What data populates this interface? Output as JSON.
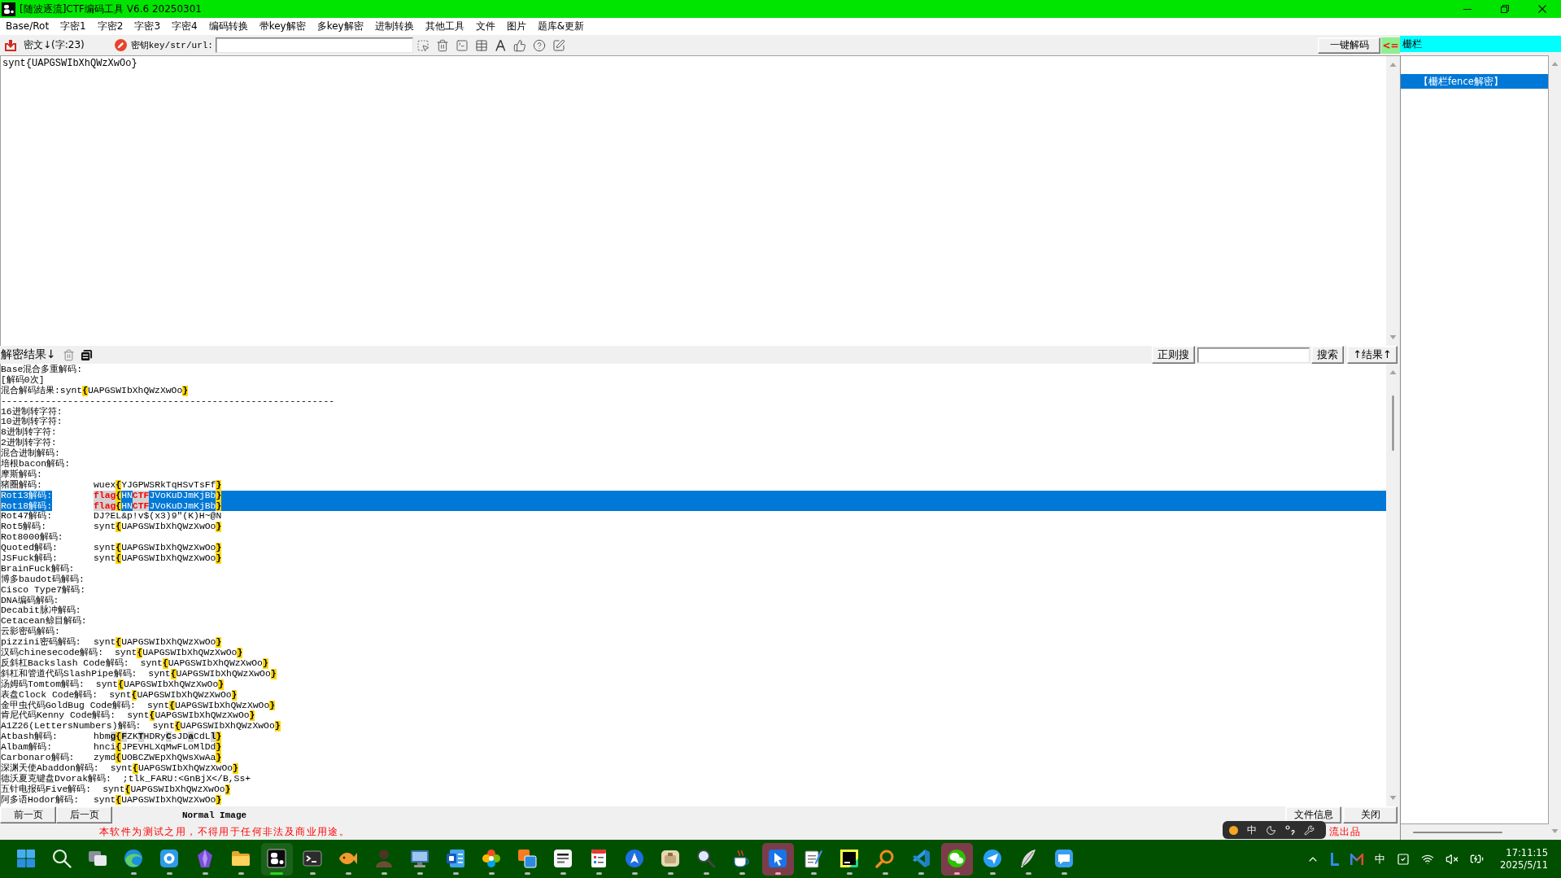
{
  "window": {
    "title": "[随波逐流]CTF编码工具 V6.6 20250301"
  },
  "menu": [
    "Base/Rot",
    "字密1",
    "字密2",
    "字密3",
    "字密4",
    "编码转换",
    "带key解密",
    "多key解密",
    "进制转换",
    "其他工具",
    "文件",
    "图片",
    "题库&更新"
  ],
  "toolbar": {
    "cipher_label": "密文↓(字:23)",
    "key_label": "密钥key/str/url:",
    "decode_button": "一键解码",
    "arrow": "<="
  },
  "mode_field": {
    "value": "栅栏"
  },
  "ciphertext": {
    "value": "synt{UAPGSWIbXhQWzXwOo}"
  },
  "results_header": {
    "title": "解密结果↓",
    "regex_button": "正则搜",
    "search_button": "搜索",
    "results_button": "↑结果↑"
  },
  "results": {
    "lines": [
      {
        "kind": "plain",
        "label": "Base混合多重解码:",
        "selected": false
      },
      {
        "kind": "plain",
        "label": "[解码0次]",
        "selected": false
      },
      {
        "kind": "joined",
        "label": "混合解码结果:",
        "selected": false,
        "value": [
          {
            "text": "synt",
            "kind": "plain"
          },
          {
            "text": "{",
            "kind": "brace"
          },
          {
            "text": "UAPGSWIbXhQWzXwOo",
            "kind": "plain"
          },
          {
            "text": "}",
            "kind": "brace"
          }
        ]
      },
      {
        "kind": "plain",
        "label": "------------------------------------------------------------",
        "selected": false
      },
      {
        "kind": "plain",
        "label": "16进制转字符:",
        "selected": false
      },
      {
        "kind": "plain",
        "label": "10进制转字符:",
        "selected": false
      },
      {
        "kind": "plain",
        "label": "8进制转字符:",
        "selected": false
      },
      {
        "kind": "plain",
        "label": "2进制转字符:",
        "selected": false
      },
      {
        "kind": "plain",
        "label": "混合进制解码:",
        "selected": false
      },
      {
        "kind": "plain",
        "label": "培根bacon解码:",
        "selected": false
      },
      {
        "kind": "plain",
        "label": "摩斯解码:",
        "selected": false
      },
      {
        "kind": "pair",
        "label": "猪圈解码:",
        "selected": false,
        "value": [
          {
            "text": "wuex",
            "kind": "plain"
          },
          {
            "text": "{",
            "kind": "brace"
          },
          {
            "text": "YJGPWSRkTqHSvTsFf",
            "kind": "plain"
          },
          {
            "text": "}",
            "kind": "brace"
          }
        ]
      },
      {
        "kind": "pair",
        "label": "Rot13解码:",
        "selected": true,
        "value": [
          {
            "text": "flag",
            "kind": "flag"
          },
          {
            "text": "{",
            "kind": "brace"
          },
          {
            "text": "HN",
            "kind": "plain"
          },
          {
            "text": "CTF",
            "kind": "flag"
          },
          {
            "text": "JVoKuDJmKjBb",
            "kind": "plain"
          },
          {
            "text": "}",
            "kind": "brace"
          }
        ]
      },
      {
        "kind": "pair",
        "label": "Rot18解码:",
        "selected": true,
        "value": [
          {
            "text": "flag",
            "kind": "flag"
          },
          {
            "text": "{",
            "kind": "brace"
          },
          {
            "text": "HN",
            "kind": "plain"
          },
          {
            "text": "CTF",
            "kind": "flag"
          },
          {
            "text": "JVoKuDJmKjBb",
            "kind": "plain"
          },
          {
            "text": "}",
            "kind": "brace"
          }
        ]
      },
      {
        "kind": "pair",
        "label": "Rot47解码:",
        "selected": false,
        "value": [
          {
            "text": "DJ?EL&p!v$(x3)9\"(K)H~@N",
            "kind": "plain"
          }
        ]
      },
      {
        "kind": "pair",
        "label": "Rot5解码:",
        "selected": false,
        "value": [
          {
            "text": "synt",
            "kind": "plain"
          },
          {
            "text": "{",
            "kind": "brace"
          },
          {
            "text": "UAPGSWIbXhQWzXwOo",
            "kind": "plain"
          },
          {
            "text": "}",
            "kind": "brace"
          }
        ]
      },
      {
        "kind": "plain",
        "label": "Rot8000解码:",
        "selected": false
      },
      {
        "kind": "pair",
        "label": "Quoted解码:",
        "selected": false,
        "value": [
          {
            "text": "synt",
            "kind": "plain"
          },
          {
            "text": "{",
            "kind": "brace"
          },
          {
            "text": "UAPGSWIbXhQWzXwOo",
            "kind": "plain"
          },
          {
            "text": "}",
            "kind": "brace"
          }
        ]
      },
      {
        "kind": "pair",
        "label": "JSFuck解码:",
        "selected": false,
        "value": [
          {
            "text": "synt",
            "kind": "plain"
          },
          {
            "text": "{",
            "kind": "brace"
          },
          {
            "text": "UAPGSWIbXhQWzXwOo",
            "kind": "plain"
          },
          {
            "text": "}",
            "kind": "brace"
          }
        ]
      },
      {
        "kind": "plain",
        "label": "BrainFuck解码:",
        "selected": false
      },
      {
        "kind": "plain",
        "label": "博多baudot码解码:",
        "selected": false
      },
      {
        "kind": "plain",
        "label": "Cisco Type7解码:",
        "selected": false
      },
      {
        "kind": "plain",
        "label": "DNA编码解码:",
        "selected": false
      },
      {
        "kind": "plain",
        "label": "Decabit脉冲解码:",
        "selected": false
      },
      {
        "kind": "plain",
        "label": "Cetacean鲸目解码:",
        "selected": false
      },
      {
        "kind": "plain",
        "label": "云影密码解码:",
        "selected": false
      },
      {
        "kind": "pair",
        "label": "pizzini密码解码:",
        "selected": false,
        "value": [
          {
            "text": "synt",
            "kind": "plain"
          },
          {
            "text": "{",
            "kind": "brace"
          },
          {
            "text": "UAPGSWIbXhQWzXwOo",
            "kind": "plain"
          },
          {
            "text": "}",
            "kind": "brace"
          }
        ]
      },
      {
        "kind": "pair",
        "label": "汉码chinesecode解码:",
        "selected": false,
        "value": [
          {
            "text": "synt",
            "kind": "plain"
          },
          {
            "text": "{",
            "kind": "brace"
          },
          {
            "text": "UAPGSWIbXhQWzXwOo",
            "kind": "plain"
          },
          {
            "text": "}",
            "kind": "brace"
          }
        ]
      },
      {
        "kind": "pair",
        "label": "反斜杠Backslash Code解码:",
        "selected": false,
        "value": [
          {
            "text": "synt",
            "kind": "plain"
          },
          {
            "text": "{",
            "kind": "brace"
          },
          {
            "text": "UAPGSWIbXhQWzXwOo",
            "kind": "plain"
          },
          {
            "text": "}",
            "kind": "brace"
          }
        ]
      },
      {
        "kind": "pair",
        "label": "斜杠和管道代码SlashPipe解码:",
        "selected": false,
        "value": [
          {
            "text": "synt",
            "kind": "plain"
          },
          {
            "text": "{",
            "kind": "brace"
          },
          {
            "text": "UAPGSWIbXhQWzXwOo",
            "kind": "plain"
          },
          {
            "text": "}",
            "kind": "brace"
          }
        ]
      },
      {
        "kind": "pair",
        "label": "汤姆码Tomtom解码:",
        "selected": false,
        "value": [
          {
            "text": "synt",
            "kind": "plain"
          },
          {
            "text": "{",
            "kind": "brace"
          },
          {
            "text": "UAPGSWIbXhQWzXwOo",
            "kind": "plain"
          },
          {
            "text": "}",
            "kind": "brace"
          }
        ]
      },
      {
        "kind": "pair",
        "label": "表盘Clock Code解码:",
        "selected": false,
        "value": [
          {
            "text": "synt",
            "kind": "plain"
          },
          {
            "text": "{",
            "kind": "brace"
          },
          {
            "text": "UAPGSWIbXhQWzXwOo",
            "kind": "plain"
          },
          {
            "text": "}",
            "kind": "brace"
          }
        ]
      },
      {
        "kind": "pair",
        "label": "金甲虫代码GoldBug Code解码:",
        "selected": false,
        "value": [
          {
            "text": "synt",
            "kind": "plain"
          },
          {
            "text": "{",
            "kind": "brace"
          },
          {
            "text": "UAPGSWIbXhQWzXwOo",
            "kind": "plain"
          },
          {
            "text": "}",
            "kind": "brace"
          }
        ]
      },
      {
        "kind": "pair",
        "label": "肯尼代码Kenny Code解码:",
        "selected": false,
        "value": [
          {
            "text": "synt",
            "kind": "plain"
          },
          {
            "text": "{",
            "kind": "brace"
          },
          {
            "text": "UAPGSWIbXhQWzXwOo",
            "kind": "plain"
          },
          {
            "text": "}",
            "kind": "brace"
          }
        ]
      },
      {
        "kind": "pair",
        "label": "A1Z26(LettersNumbers)解码:",
        "selected": false,
        "value": [
          {
            "text": "synt",
            "kind": "plain"
          },
          {
            "text": "{",
            "kind": "brace"
          },
          {
            "text": "UAPGSWIbXhQWzXwOo",
            "kind": "plain"
          },
          {
            "text": "}",
            "kind": "brace"
          }
        ]
      },
      {
        "kind": "pair",
        "label": "Atbash解码:",
        "selected": false,
        "value": [
          {
            "text": "hbm",
            "kind": "plain"
          },
          {
            "text": "g",
            "kind": "hit"
          },
          {
            "text": "{",
            "kind": "brace"
          },
          {
            "text": "F",
            "kind": "hit"
          },
          {
            "text": "ZK",
            "kind": "plain"
          },
          {
            "text": "T",
            "kind": "hit"
          },
          {
            "text": "HDRy",
            "kind": "plain"
          },
          {
            "text": "C",
            "kind": "hit"
          },
          {
            "text": "sJD",
            "kind": "plain"
          },
          {
            "text": "a",
            "kind": "hit"
          },
          {
            "text": "CdL",
            "kind": "plain"
          },
          {
            "text": "l",
            "kind": "hit"
          },
          {
            "text": "}",
            "kind": "brace"
          }
        ]
      },
      {
        "kind": "pair",
        "label": "Albam解码:",
        "selected": false,
        "value": [
          {
            "text": "hnci",
            "kind": "plain"
          },
          {
            "text": "{",
            "kind": "brace"
          },
          {
            "text": "JPEVHLXqMwFLoMlDd",
            "kind": "plain"
          },
          {
            "text": "}",
            "kind": "brace"
          }
        ]
      },
      {
        "kind": "pair",
        "label": "Carbonaro解码:",
        "selected": false,
        "value": [
          {
            "text": "zymd",
            "kind": "plain"
          },
          {
            "text": "{",
            "kind": "brace"
          },
          {
            "text": "UOBCZWEpXhQWsXwAa",
            "kind": "plain"
          },
          {
            "text": "}",
            "kind": "brace"
          }
        ]
      },
      {
        "kind": "pair",
        "label": "深渊天使Abaddon解码:",
        "selected": false,
        "value": [
          {
            "text": "synt",
            "kind": "plain"
          },
          {
            "text": "{",
            "kind": "brace"
          },
          {
            "text": "UAPGSWIbXhQWzXwOo",
            "kind": "plain"
          },
          {
            "text": "}",
            "kind": "brace"
          }
        ]
      },
      {
        "kind": "pair",
        "label": "德沃夏克键盘Dvorak解码:",
        "selected": false,
        "value": [
          {
            "text": ";tlk_FARU:<GnBjX</B,Ss+",
            "kind": "plain"
          }
        ]
      },
      {
        "kind": "pair",
        "label": "五针电报码Five解码:",
        "selected": false,
        "value": [
          {
            "text": "synt",
            "kind": "plain"
          },
          {
            "text": "{",
            "kind": "brace"
          },
          {
            "text": "UAPGSWIbXhQWzXwOo",
            "kind": "plain"
          },
          {
            "text": "}",
            "kind": "brace"
          }
        ]
      },
      {
        "kind": "pair",
        "label": "阿多语Hodor解码:",
        "selected": false,
        "value": [
          {
            "text": "synt",
            "kind": "plain"
          },
          {
            "text": "{",
            "kind": "brace"
          },
          {
            "text": "UAPGSWIbXhQWzXwOo",
            "kind": "plain"
          },
          {
            "text": "}",
            "kind": "brace"
          }
        ]
      }
    ]
  },
  "footer": {
    "prev_button": "前一页",
    "next_button": "后一页",
    "image_mode": "Normal Image",
    "info_button": "文件信息",
    "close_button": "关闭",
    "notice": "本软件为测试之用，不得用于任何非法及商业用途。",
    "credit": "流出品"
  },
  "methods": {
    "items": [
      {
        "label": "【栅栏fence解密】",
        "selected": true
      }
    ]
  },
  "ime_toolbar": {
    "mode": "中"
  },
  "taskbar": {
    "apps": [
      {
        "kind": "start",
        "running": false,
        "selected": false,
        "attention": false
      },
      {
        "kind": "search",
        "running": false,
        "selected": false,
        "attention": false
      },
      {
        "kind": "taskview",
        "running": false,
        "selected": false,
        "attention": false
      },
      {
        "kind": "browser",
        "running": true,
        "selected": false,
        "attention": false
      },
      {
        "kind": "ring",
        "running": true,
        "selected": false,
        "attention": false
      },
      {
        "kind": "crystal",
        "running": true,
        "selected": false,
        "attention": false
      },
      {
        "kind": "folder",
        "running": true,
        "selected": false,
        "attention": false
      },
      {
        "kind": "logo",
        "running": true,
        "selected": true,
        "attention": false
      },
      {
        "kind": "terminal",
        "running": true,
        "selected": false,
        "attention": false
      },
      {
        "kind": "fish",
        "running": true,
        "selected": false,
        "attention": false
      },
      {
        "kind": "person",
        "running": true,
        "selected": false,
        "attention": false
      },
      {
        "kind": "monitor",
        "running": true,
        "selected": false,
        "attention": false
      },
      {
        "kind": "document",
        "running": true,
        "selected": false,
        "attention": false
      },
      {
        "kind": "flower",
        "running": true,
        "selected": false,
        "attention": false
      },
      {
        "kind": "squares",
        "running": true,
        "selected": false,
        "attention": false
      },
      {
        "kind": "page",
        "running": true,
        "selected": false,
        "attention": false
      },
      {
        "kind": "checklist",
        "running": true,
        "selected": false,
        "attention": false
      },
      {
        "kind": "navigation",
        "running": true,
        "selected": false,
        "attention": false
      },
      {
        "kind": "box",
        "running": true,
        "selected": false,
        "attention": false
      },
      {
        "kind": "magnifier",
        "running": true,
        "selected": false,
        "attention": false
      },
      {
        "kind": "cup",
        "running": true,
        "selected": false,
        "attention": false
      },
      {
        "kind": "cursor",
        "running": true,
        "selected": false,
        "attention": true
      },
      {
        "kind": "notepad",
        "running": true,
        "selected": false,
        "attention": false
      },
      {
        "kind": "ide",
        "running": true,
        "selected": false,
        "attention": false
      },
      {
        "kind": "lens",
        "running": true,
        "selected": false,
        "attention": false
      },
      {
        "kind": "code",
        "running": true,
        "selected": false,
        "attention": false
      },
      {
        "kind": "bubbles",
        "running": true,
        "selected": false,
        "attention": true
      },
      {
        "kind": "plane",
        "running": true,
        "selected": false,
        "attention": false
      },
      {
        "kind": "feather",
        "running": true,
        "selected": false,
        "attention": false
      },
      {
        "kind": "message",
        "running": true,
        "selected": false,
        "attention": false
      }
    ],
    "tray": {
      "ime": "中",
      "muted": true
    },
    "time": "17:11:15",
    "date": "2025/5/11"
  }
}
